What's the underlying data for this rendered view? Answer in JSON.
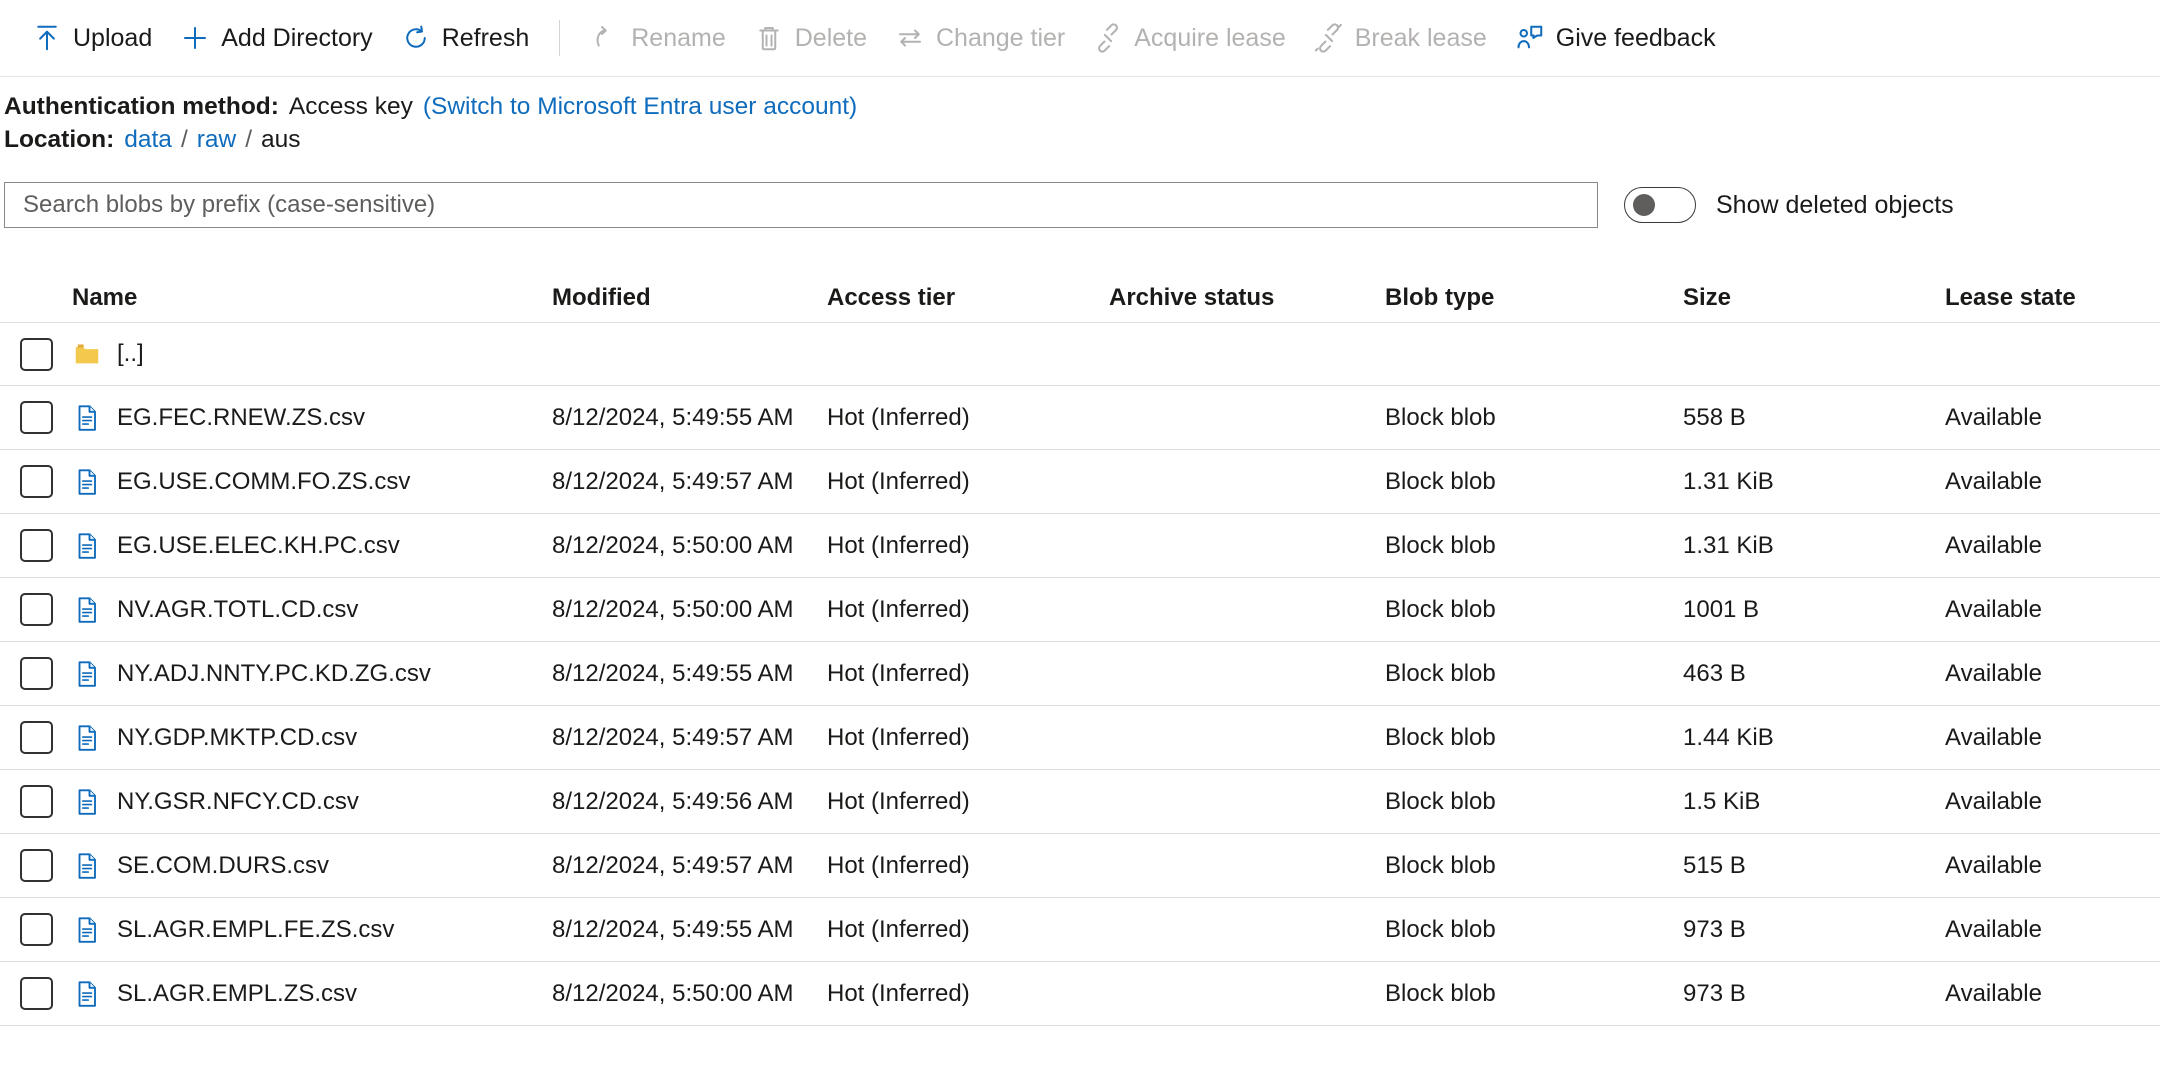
{
  "toolbar": {
    "items": [
      {
        "label": "Upload",
        "icon": "upload-icon",
        "enabled": true
      },
      {
        "label": "Add Directory",
        "icon": "plus-icon",
        "enabled": true
      },
      {
        "label": "Refresh",
        "icon": "refresh-icon",
        "enabled": true
      },
      {
        "label": "Rename",
        "icon": "rename-icon",
        "enabled": false
      },
      {
        "label": "Delete",
        "icon": "trash-icon",
        "enabled": false
      },
      {
        "label": "Change tier",
        "icon": "swap-icon",
        "enabled": false
      },
      {
        "label": "Acquire lease",
        "icon": "lease-icon",
        "enabled": false
      },
      {
        "label": "Break lease",
        "icon": "break-lease-icon",
        "enabled": false
      },
      {
        "label": "Give feedback",
        "icon": "give-feedback-icon",
        "enabled": true
      }
    ]
  },
  "info": {
    "auth_label": "Authentication method:",
    "auth_value": "Access key",
    "auth_switch_link": "(Switch to Microsoft Entra user account)",
    "location_label": "Location:",
    "breadcrumb": [
      {
        "text": "data",
        "link": true
      },
      {
        "text": "raw",
        "link": true
      },
      {
        "text": "aus",
        "link": false
      }
    ],
    "breadcrumb_separator": "/"
  },
  "search": {
    "placeholder": "Search blobs by prefix (case-sensitive)",
    "value": ""
  },
  "show_deleted_toggle": {
    "label": "Show deleted objects",
    "state": "off"
  },
  "table": {
    "columns": [
      "Name",
      "Modified",
      "Access tier",
      "Archive status",
      "Blob type",
      "Size",
      "Lease state"
    ],
    "rows": [
      {
        "icon": "folder-icon",
        "name": "[..]",
        "modified": "",
        "access_tier": "",
        "archive_status": "",
        "blob_type": "",
        "size": "",
        "lease_state": ""
      },
      {
        "icon": "file-icon",
        "name": "EG.FEC.RNEW.ZS.csv",
        "modified": "8/12/2024, 5:49:55 AM",
        "access_tier": "Hot (Inferred)",
        "archive_status": "",
        "blob_type": "Block blob",
        "size": "558 B",
        "lease_state": "Available"
      },
      {
        "icon": "file-icon",
        "name": "EG.USE.COMM.FO.ZS.csv",
        "modified": "8/12/2024, 5:49:57 AM",
        "access_tier": "Hot (Inferred)",
        "archive_status": "",
        "blob_type": "Block blob",
        "size": "1.31 KiB",
        "lease_state": "Available"
      },
      {
        "icon": "file-icon",
        "name": "EG.USE.ELEC.KH.PC.csv",
        "modified": "8/12/2024, 5:50:00 AM",
        "access_tier": "Hot (Inferred)",
        "archive_status": "",
        "blob_type": "Block blob",
        "size": "1.31 KiB",
        "lease_state": "Available"
      },
      {
        "icon": "file-icon",
        "name": "NV.AGR.TOTL.CD.csv",
        "modified": "8/12/2024, 5:50:00 AM",
        "access_tier": "Hot (Inferred)",
        "archive_status": "",
        "blob_type": "Block blob",
        "size": "1001 B",
        "lease_state": "Available"
      },
      {
        "icon": "file-icon",
        "name": "NY.ADJ.NNTY.PC.KD.ZG.csv",
        "modified": "8/12/2024, 5:49:55 AM",
        "access_tier": "Hot (Inferred)",
        "archive_status": "",
        "blob_type": "Block blob",
        "size": "463 B",
        "lease_state": "Available"
      },
      {
        "icon": "file-icon",
        "name": "NY.GDP.MKTP.CD.csv",
        "modified": "8/12/2024, 5:49:57 AM",
        "access_tier": "Hot (Inferred)",
        "archive_status": "",
        "blob_type": "Block blob",
        "size": "1.44 KiB",
        "lease_state": "Available"
      },
      {
        "icon": "file-icon",
        "name": "NY.GSR.NFCY.CD.csv",
        "modified": "8/12/2024, 5:49:56 AM",
        "access_tier": "Hot (Inferred)",
        "archive_status": "",
        "blob_type": "Block blob",
        "size": "1.5 KiB",
        "lease_state": "Available"
      },
      {
        "icon": "file-icon",
        "name": "SE.COM.DURS.csv",
        "modified": "8/12/2024, 5:49:57 AM",
        "access_tier": "Hot (Inferred)",
        "archive_status": "",
        "blob_type": "Block blob",
        "size": "515 B",
        "lease_state": "Available"
      },
      {
        "icon": "file-icon",
        "name": "SL.AGR.EMPL.FE.ZS.csv",
        "modified": "8/12/2024, 5:49:55 AM",
        "access_tier": "Hot (Inferred)",
        "archive_status": "",
        "blob_type": "Block blob",
        "size": "973 B",
        "lease_state": "Available"
      },
      {
        "icon": "file-icon",
        "name": "SL.AGR.EMPL.ZS.csv",
        "modified": "8/12/2024, 5:50:00 AM",
        "access_tier": "Hot (Inferred)",
        "archive_status": "",
        "blob_type": "Block blob",
        "size": "973 B",
        "lease_state": "Available"
      }
    ]
  },
  "colors": {
    "accent": "#0f6cbd",
    "disabled": "#b4b2b0",
    "folder": "#f2c94c",
    "text": "#1b1a19"
  }
}
